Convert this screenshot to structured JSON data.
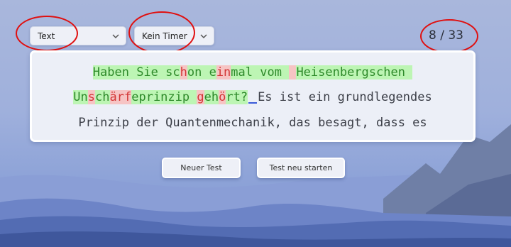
{
  "controls": {
    "mode_value": "Text",
    "timer_value": "Kein Timer"
  },
  "progress": {
    "counter": "8 / 33"
  },
  "text": {
    "line1": [
      {
        "t": "Haben Sie sc",
        "s": "ok"
      },
      {
        "t": "h",
        "s": "err"
      },
      {
        "t": "on e",
        "s": "ok"
      },
      {
        "t": "in",
        "s": "err"
      },
      {
        "t": "mal vom ",
        "s": "ok"
      },
      {
        "t": " ",
        "s": "err"
      },
      {
        "t": "Heisenbergschen ",
        "s": "ok"
      }
    ],
    "line2": [
      {
        "t": "Un",
        "s": "ok"
      },
      {
        "t": "s",
        "s": "err"
      },
      {
        "t": "ch",
        "s": "ok"
      },
      {
        "t": "ärf",
        "s": "err"
      },
      {
        "t": "eprinzip ",
        "s": "ok"
      },
      {
        "t": "g",
        "s": "err"
      },
      {
        "t": "eh",
        "s": "ok"
      },
      {
        "t": "ö",
        "s": "err"
      },
      {
        "t": "rt?",
        "s": "ok"
      },
      {
        "t": "",
        "s": "caret"
      },
      {
        "t": "Es ist ein grundlegendes",
        "s": "pending"
      }
    ],
    "line3": [
      {
        "t": "Prinzip der Quantenmechanik, das besagt, dass es",
        "s": "pending"
      }
    ]
  },
  "buttons": {
    "new_test": "Neuer Test",
    "restart": "Test neu starten"
  },
  "colors": {
    "correct_bg": "#bdf5b4",
    "incorrect_bg": "#f6c4c4",
    "caret": "#3a5ad8",
    "annotation": "#e01010"
  }
}
